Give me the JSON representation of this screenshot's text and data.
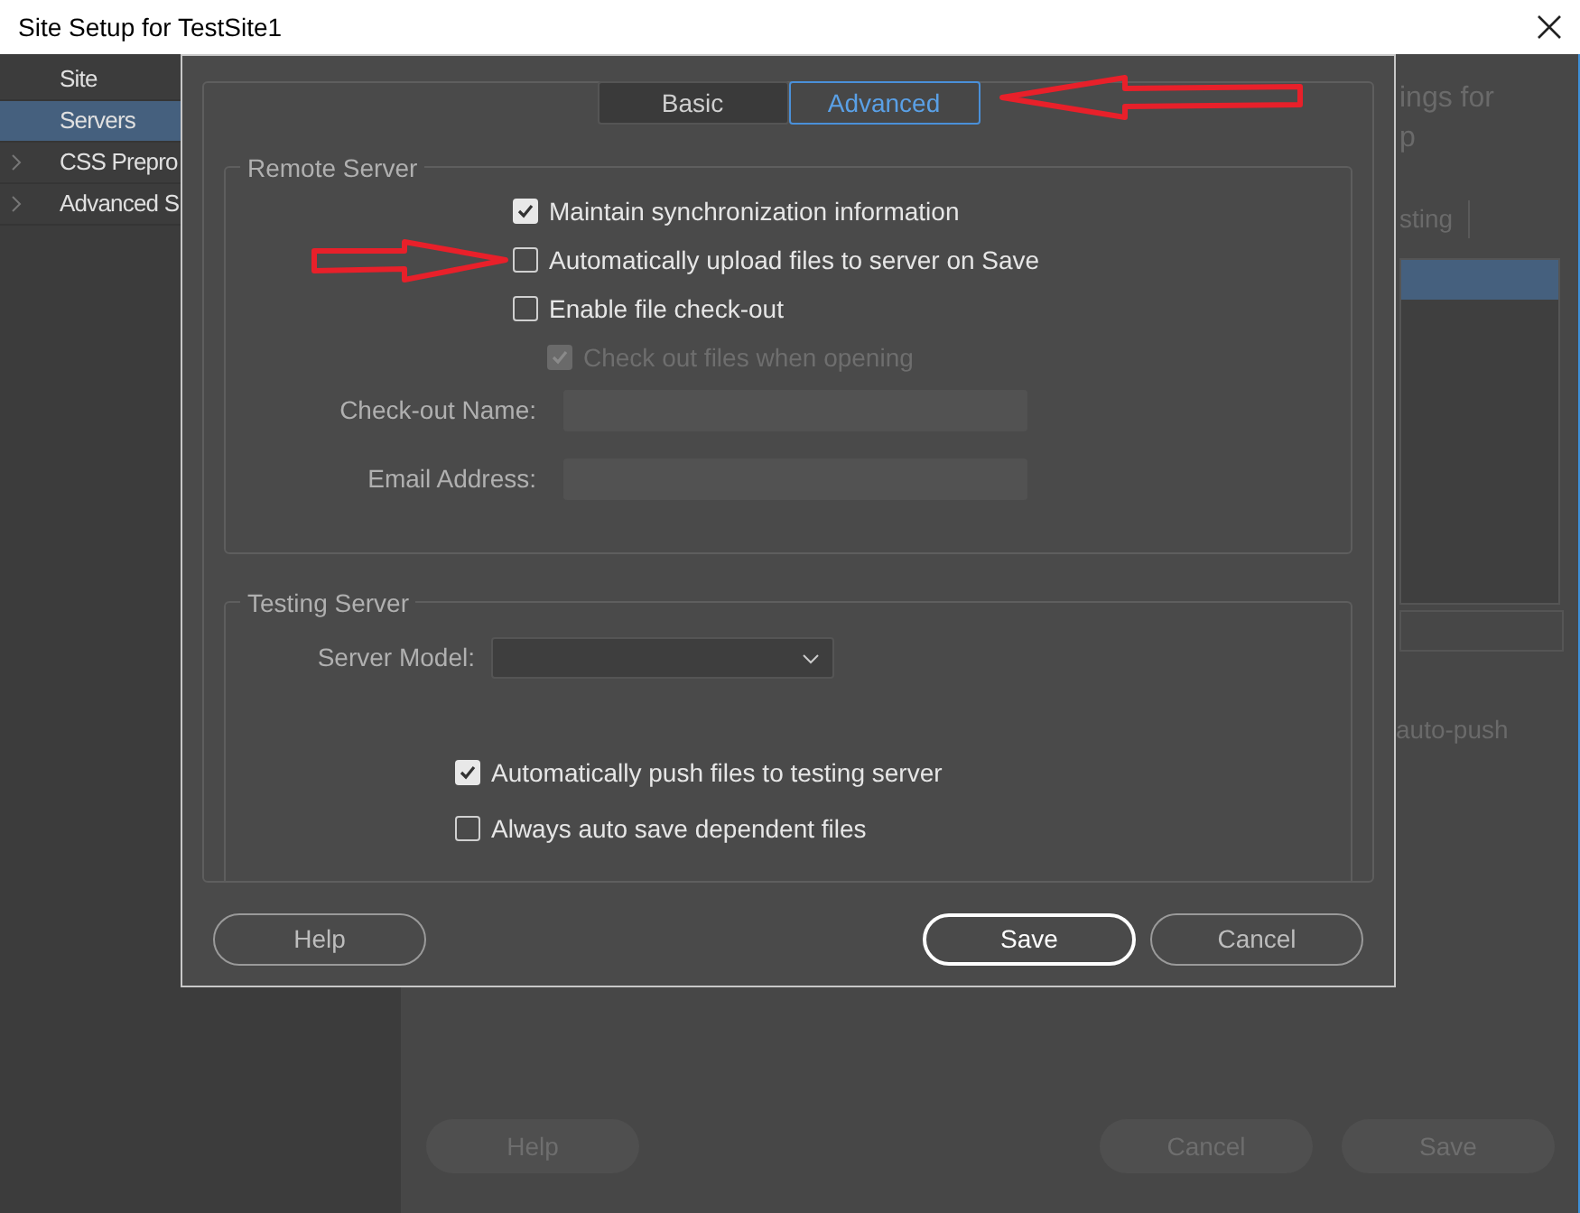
{
  "window": {
    "title": "Site Setup for TestSite1"
  },
  "sidebar": {
    "items": [
      {
        "label": "Site",
        "selected": false,
        "expandable": false
      },
      {
        "label": "Servers",
        "selected": true,
        "expandable": false
      },
      {
        "label": "CSS Prepro",
        "selected": false,
        "expandable": true
      },
      {
        "label": "Advanced S",
        "selected": false,
        "expandable": true
      }
    ]
  },
  "background": {
    "heading": [
      "ings for",
      "p"
    ],
    "table_header": "sting",
    "note": "auto-push",
    "buttons": [
      {
        "label": "Help"
      },
      {
        "label": "Cancel"
      },
      {
        "label": "Save"
      }
    ]
  },
  "dialog": {
    "tabs": [
      {
        "label": "Basic",
        "selected": false
      },
      {
        "label": "Advanced",
        "selected": true
      }
    ],
    "remote_server": {
      "title": "Remote Server",
      "options": [
        {
          "label": "Maintain synchronization information",
          "checked": true,
          "disabled": false
        },
        {
          "label": "Automatically upload files to server on Save",
          "checked": false,
          "disabled": false
        },
        {
          "label": "Enable file check-out",
          "checked": false,
          "disabled": false,
          "children": [
            {
              "label": "Check out files when opening",
              "checked": true,
              "disabled": true
            }
          ]
        }
      ],
      "fields": [
        {
          "label": "Check-out Name:"
        },
        {
          "label": "Email Address:"
        }
      ]
    },
    "testing_server": {
      "title": "Testing Server",
      "server_model": {
        "label": "Server Model:"
      },
      "options": [
        {
          "label": "Automatically push files to testing server",
          "checked": true,
          "disabled": false
        },
        {
          "label": "Always auto save dependent files",
          "checked": false,
          "disabled": false
        }
      ]
    },
    "buttons": [
      {
        "label": "Help",
        "kind": "secondary"
      },
      {
        "label": "Save",
        "kind": "default"
      },
      {
        "label": "Cancel",
        "kind": "secondary"
      }
    ]
  }
}
